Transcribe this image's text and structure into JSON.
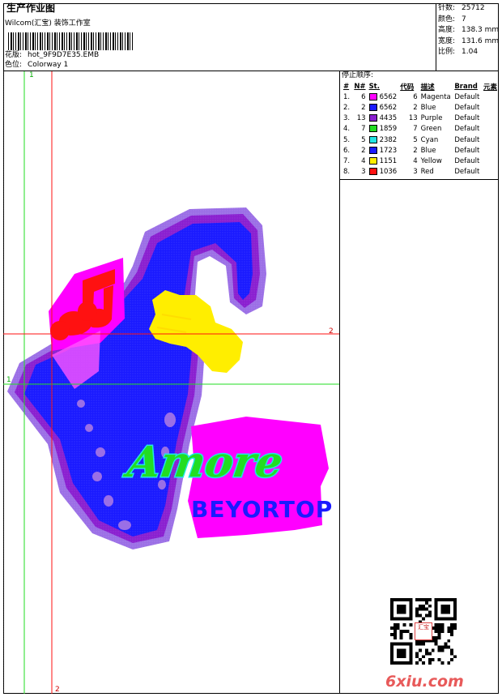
{
  "header": {
    "title": "生产作业图",
    "company": "Wilcom(汇宝) 装饰工作室",
    "design_label": "花版:",
    "design_file": "hot_9F9D7E35.EMB",
    "colorway_label": "色位:",
    "colorway": "Colorway 1"
  },
  "stats": [
    {
      "label": "针数:",
      "value": "25712"
    },
    {
      "label": "颜色:",
      "value": "7"
    },
    {
      "label": "高度:",
      "value": "138.3 mm"
    },
    {
      "label": "宽度:",
      "value": "131.6 mm"
    },
    {
      "label": "比例:",
      "value": "1.04"
    }
  ],
  "guides": {
    "marker_1_top": "1",
    "marker_1_left": "1",
    "marker_2_right": "2",
    "marker_2_bottom": "2"
  },
  "artwork": {
    "word1": "Amore",
    "word2": "BEYORTOP"
  },
  "stop_sequence": {
    "label": "停止顺序:",
    "headers": [
      "#",
      "N#",
      "St.",
      "代码",
      "描述",
      "Brand",
      "元素"
    ],
    "rows": [
      {
        "idx": "1.",
        "n": "6",
        "color": "#ff00ff",
        "st": "6562",
        "code": "6",
        "desc": "Magenta",
        "brand": "Default"
      },
      {
        "idx": "2.",
        "n": "2",
        "color": "#1a1aff",
        "st": "6562",
        "code": "2",
        "desc": "Blue",
        "brand": "Default"
      },
      {
        "idx": "3.",
        "n": "13",
        "color": "#8a1fd0",
        "st": "4435",
        "code": "13",
        "desc": "Purple",
        "brand": "Default"
      },
      {
        "idx": "4.",
        "n": "7",
        "color": "#22dd22",
        "st": "1859",
        "code": "7",
        "desc": "Green",
        "brand": "Default"
      },
      {
        "idx": "5.",
        "n": "5",
        "color": "#22e5e5",
        "st": "2382",
        "code": "5",
        "desc": "Cyan",
        "brand": "Default"
      },
      {
        "idx": "6.",
        "n": "2",
        "color": "#1a1aff",
        "st": "1723",
        "code": "2",
        "desc": "Blue",
        "brand": "Default"
      },
      {
        "idx": "7.",
        "n": "4",
        "color": "#ffee00",
        "st": "1151",
        "code": "4",
        "desc": "Yellow",
        "brand": "Default"
      },
      {
        "idx": "8.",
        "n": "3",
        "color": "#ff1111",
        "st": "1036",
        "code": "3",
        "desc": "Red",
        "brand": "Default"
      }
    ]
  },
  "watermark": {
    "site": "6xiu.com",
    "seal": "汇宝"
  }
}
